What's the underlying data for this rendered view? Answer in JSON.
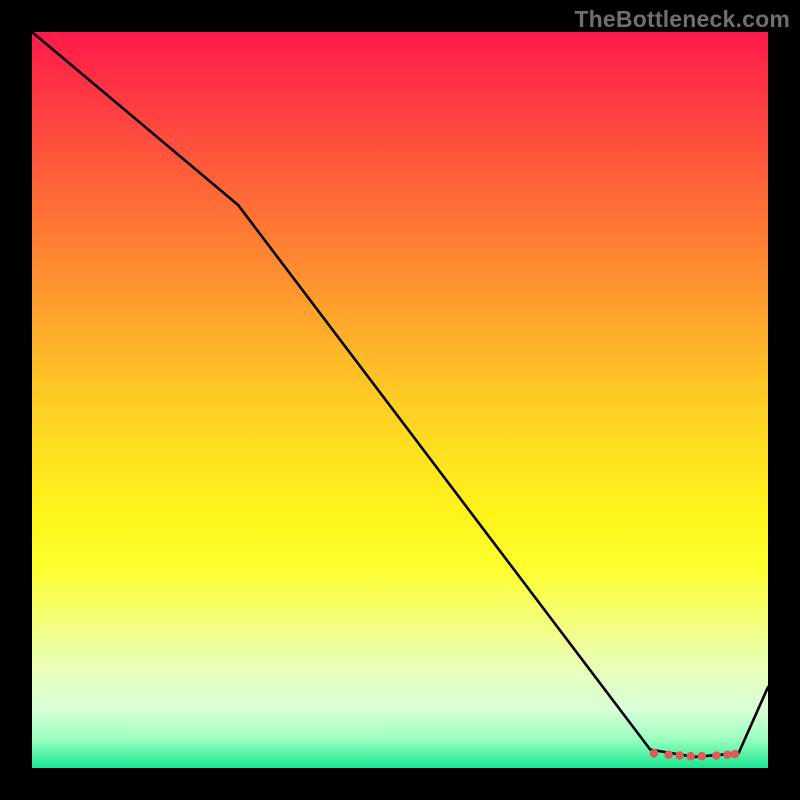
{
  "watermark": "TheBottleneck.com",
  "chart_data": {
    "type": "line",
    "title": "",
    "xlabel": "",
    "ylabel": "",
    "xlim": [
      0,
      100
    ],
    "ylim": [
      0,
      100
    ],
    "grid": false,
    "series": [
      {
        "name": "curve",
        "x": [
          0,
          28,
          84,
          90,
          96,
          100
        ],
        "values": [
          100,
          76.5,
          2.5,
          1.5,
          2.0,
          11
        ]
      }
    ],
    "markers": {
      "name": "flat-region-dots",
      "x": [
        84.5,
        86.5,
        88.0,
        89.5,
        91.0,
        93.0,
        94.5,
        95.5
      ],
      "y": [
        2.0,
        1.8,
        1.7,
        1.6,
        1.6,
        1.7,
        1.8,
        1.9
      ],
      "color": "#e05a5a",
      "weight": "bold"
    },
    "background_gradient": {
      "orientation": "vertical",
      "stops": [
        {
          "pos": 0,
          "color": "#ff1a4b"
        },
        {
          "pos": 50,
          "color": "#ffc626"
        },
        {
          "pos": 75,
          "color": "#fff51a"
        },
        {
          "pos": 100,
          "color": "#18e890"
        }
      ]
    }
  }
}
